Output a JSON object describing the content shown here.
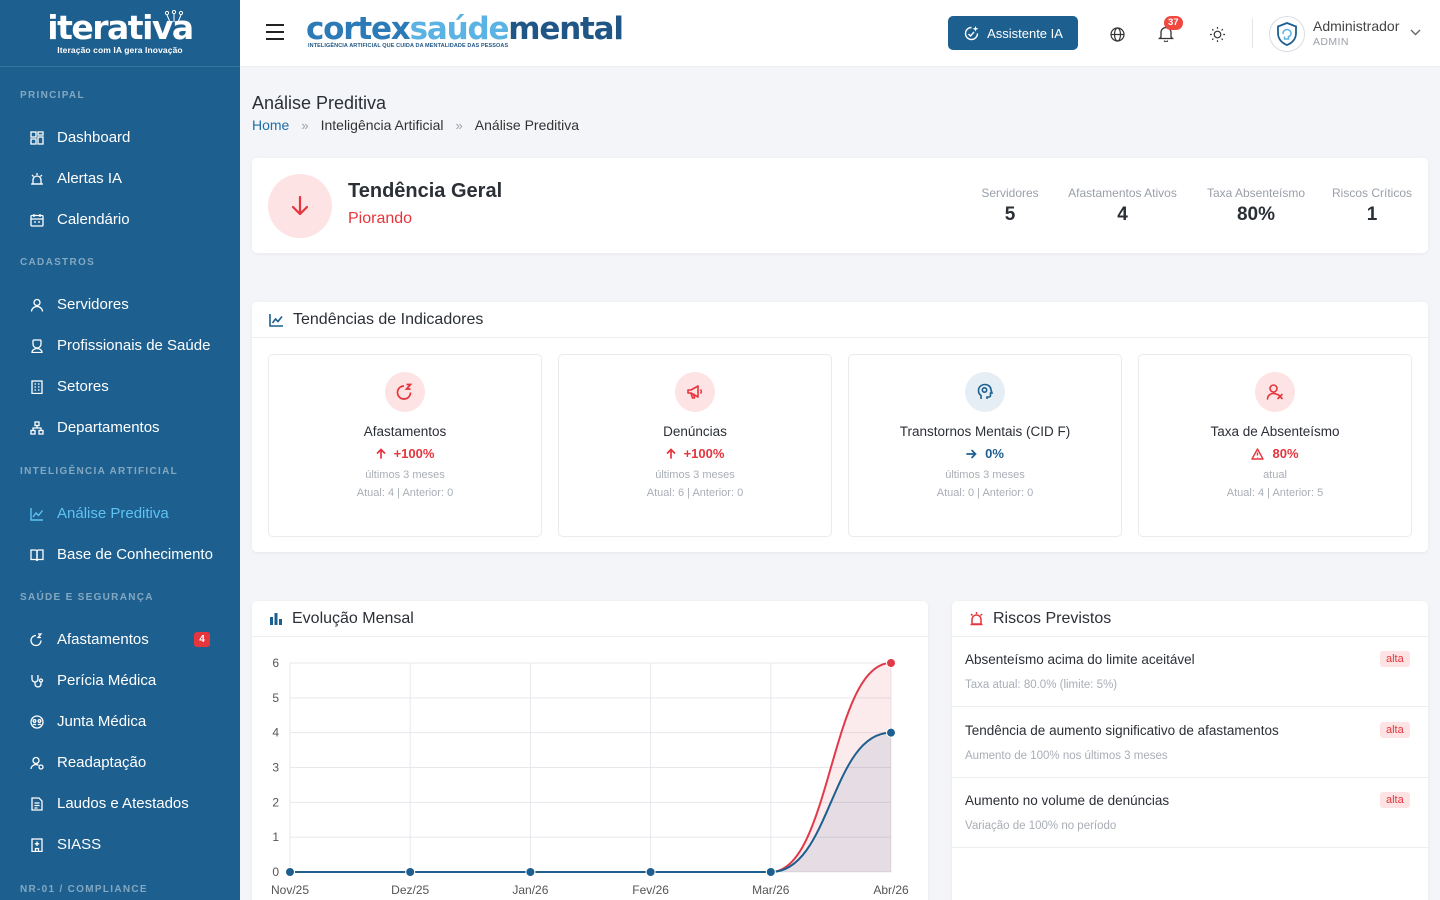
{
  "brand": {
    "name": "iterativa",
    "tagline": "Iteração com IA gera Inovação"
  },
  "sidebar": {
    "sections": [
      {
        "title": "PRINCIPAL",
        "items": [
          {
            "label": "Dashboard",
            "icon": "grid-icon"
          },
          {
            "label": "Alertas IA",
            "icon": "siren-icon"
          },
          {
            "label": "Calendário",
            "icon": "calendar-icon"
          }
        ]
      },
      {
        "title": "CADASTROS",
        "items": [
          {
            "label": "Servidores",
            "icon": "user-icon"
          },
          {
            "label": "Profissionais de Saúde",
            "icon": "doctor-icon"
          },
          {
            "label": "Setores",
            "icon": "building-icon"
          },
          {
            "label": "Departamentos",
            "icon": "hierarchy-icon"
          }
        ]
      },
      {
        "title": "INTELIGÊNCIA ARTIFICIAL",
        "items": [
          {
            "label": "Análise Preditiva",
            "icon": "chart-line-icon",
            "active": true
          },
          {
            "label": "Base de Conhecimento",
            "icon": "book-icon"
          }
        ]
      },
      {
        "title": "SAÚDE E SEGURANÇA",
        "items": [
          {
            "label": "Afastamentos",
            "icon": "sleep-icon",
            "badge": "4"
          },
          {
            "label": "Perícia Médica",
            "icon": "stethoscope-icon"
          },
          {
            "label": "Junta Médica",
            "icon": "group-icon"
          },
          {
            "label": "Readaptação",
            "icon": "user-cycle-icon"
          },
          {
            "label": "Laudos e Atestados",
            "icon": "file-icon"
          },
          {
            "label": "SIASS",
            "icon": "hospital-icon"
          }
        ]
      },
      {
        "title": "NR-01 / COMPLIANCE",
        "items": []
      }
    ]
  },
  "header": {
    "logo": {
      "part1": "cortex",
      "part2": "saúde",
      "part3": "mental",
      "subtitle": "INTELIGÊNCIA ARTIFICIAL QUE CUIDA DA MENTALIDADE DAS PESSOAS"
    },
    "ai_button": "Assistente IA",
    "notifications": "37",
    "user": {
      "name": "Administrador",
      "role": "ADMIN"
    }
  },
  "page": {
    "title": "Análise Preditiva",
    "breadcrumb": [
      "Home",
      "Inteligência Artificial",
      "Análise Preditiva"
    ]
  },
  "trend": {
    "title": "Tendência Geral",
    "status": "Piorando",
    "stats": [
      {
        "label": "Servidores",
        "value": "5"
      },
      {
        "label": "Afastamentos Ativos",
        "value": "4"
      },
      {
        "label": "Taxa Absenteísmo",
        "value": "80%"
      },
      {
        "label": "Riscos Críticos",
        "value": "1"
      }
    ]
  },
  "indicators": {
    "title": "Tendências de Indicadores",
    "items": [
      {
        "name": "Afastamentos",
        "change": "+100%",
        "period": "últimos 3 meses",
        "comparison": "Atual: 4 | Anterior: 0",
        "icon": "sleep-icon",
        "color": "#e5353d",
        "bg": "#fde3e3",
        "direction": "up"
      },
      {
        "name": "Denúncias",
        "change": "+100%",
        "period": "últimos 3 meses",
        "comparison": "Atual: 6 | Anterior: 0",
        "icon": "megaphone-icon",
        "color": "#e5353d",
        "bg": "#fde3e3",
        "direction": "up"
      },
      {
        "name": "Transtornos Mentais (CID F)",
        "change": "0%",
        "period": "últimos 3 meses",
        "comparison": "Atual: 0 | Anterior: 0",
        "icon": "brain-head-icon",
        "color": "#1d5f8f",
        "bg": "#e6eef5",
        "direction": "flat"
      },
      {
        "name": "Taxa de Absenteísmo",
        "change": "80%",
        "period": "atual",
        "comparison": "Atual: 4 | Anterior: 5",
        "icon": "user-x-icon",
        "color": "#e5353d",
        "bg": "#fde3e3",
        "direction": "warning"
      }
    ]
  },
  "chart": {
    "title": "Evolução Mensal"
  },
  "chart_data": {
    "type": "line",
    "x": [
      "Nov/25",
      "Dez/25",
      "Jan/26",
      "Fev/26",
      "Mar/26",
      "Abr/26"
    ],
    "series": [
      {
        "values": [
          0,
          0,
          0,
          0,
          0,
          6
        ],
        "color": "#e0394a"
      },
      {
        "values": [
          0,
          0,
          0,
          0,
          0,
          4
        ],
        "color": "#1d5f8f"
      }
    ],
    "ylim": [
      0,
      6
    ],
    "yticks": [
      "0",
      "1",
      "2",
      "3",
      "4",
      "5",
      "6"
    ],
    "grid": true
  },
  "risks": {
    "title": "Riscos Previstos",
    "items": [
      {
        "title": "Absenteísmo acima do limite aceitável",
        "desc": "Taxa atual: 80.0% (limite: 5%)",
        "level": "alta"
      },
      {
        "title": "Tendência de aumento significativo de afastamentos",
        "desc": "Aumento de 100% nos últimos 3 meses",
        "level": "alta"
      },
      {
        "title": "Aumento no volume de denúncias",
        "desc": "Variação de 100% no período",
        "level": "alta"
      }
    ]
  }
}
